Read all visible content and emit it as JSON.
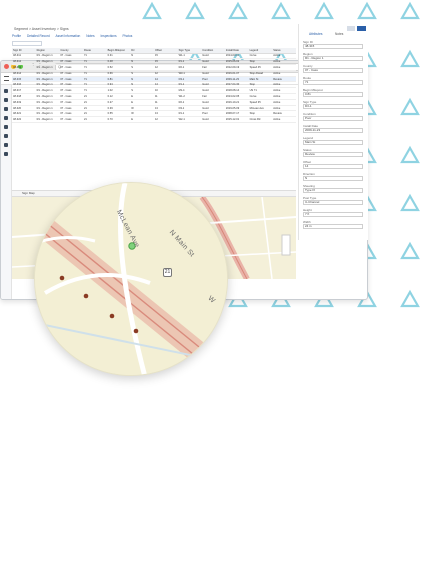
{
  "window": {
    "url": "Q",
    "app_logo": "AgileAssets"
  },
  "breadcrumb": "Segment  >  Asset Inventory  >  Signs",
  "tabs": [
    "Profile",
    "Detailed Record",
    "Asset Information",
    "Notes",
    "Inspections",
    "Photos"
  ],
  "grid": {
    "columns": [
      "Sign ID",
      "Region",
      "County",
      "Route",
      "Begin Milepost",
      "Dir",
      "Offset",
      "Sign Type",
      "Condition",
      "Install Date",
      "Legend",
      "Status"
    ],
    "rows": [
      [
        "48-311",
        "R1 - Region 1",
        "07 - Cass",
        "71",
        "0.31",
        "N",
        "15",
        "W1-1",
        "Good",
        "2014-03-11",
        "Curve",
        "Active"
      ],
      [
        "48-312",
        "R1 - Region 1",
        "07 - Cass",
        "71",
        "0.48",
        "N",
        "15",
        "R1-1",
        "Good",
        "2015-06-02",
        "Stop",
        "Active"
      ],
      [
        "48-313",
        "R1 - Region 1",
        "07 - Cass",
        "71",
        "0.52",
        "S",
        "12",
        "R2-1",
        "Fair",
        "2012-09-19",
        "Speed 45",
        "Active"
      ],
      [
        "48-314",
        "R1 - Region 1",
        "07 - Cass",
        "71",
        "0.66",
        "S",
        "12",
        "W3-1",
        "Good",
        "2016-01-07",
        "Stop Ahead",
        "Active"
      ],
      [
        "48-315",
        "R1 - Region 1",
        "07 - Cass",
        "71",
        "0.81",
        "N",
        "14",
        "D3-1",
        "Poor",
        "2009-11-23",
        "Main St",
        "Review"
      ],
      [
        "48-316",
        "R1 - Region 1",
        "07 - Cass",
        "71",
        "0.94",
        "N",
        "14",
        "R1-1",
        "Good",
        "2017-04-30",
        "Stop",
        "Active"
      ],
      [
        "48-317",
        "R1 - Region 1",
        "07 - Cass",
        "71",
        "1.02",
        "S",
        "10",
        "M1-4",
        "Good",
        "2018-08-14",
        "US 71",
        "Active"
      ],
      [
        "48-318",
        "R1 - Region 1",
        "07 - Cass",
        "21",
        "0.12",
        "E",
        "11",
        "W1-2",
        "Fair",
        "2013-02-05",
        "Curve",
        "Active"
      ],
      [
        "48-319",
        "R1 - Region 1",
        "07 - Cass",
        "21",
        "0.27",
        "E",
        "11",
        "R2-1",
        "Good",
        "2016-10-21",
        "Speed 35",
        "Active"
      ],
      [
        "48-320",
        "R1 - Region 1",
        "07 - Cass",
        "21",
        "0.39",
        "W",
        "13",
        "D3-1",
        "Good",
        "2019-05-09",
        "McLean Ave",
        "Active"
      ],
      [
        "48-321",
        "R1 - Region 1",
        "07 - Cass",
        "21",
        "0.55",
        "W",
        "13",
        "R1-1",
        "Poor",
        "2008-07-17",
        "Stop",
        "Review"
      ],
      [
        "48-322",
        "R1 - Region 1",
        "07 - Cass",
        "21",
        "0.70",
        "E",
        "12",
        "W2-1",
        "Good",
        "2015-12-01",
        "Cross Rd",
        "Active"
      ]
    ],
    "selected_row": 4
  },
  "map_bar": "Sign Map",
  "map": {
    "road_labels": [
      "McLean Ave",
      "N Main St",
      "W"
    ],
    "route_shield": "21"
  },
  "right_panel": {
    "tab_1": "Attributes",
    "tab_2": "Notes",
    "fields": [
      {
        "label": "Sign ID",
        "value": "48-315"
      },
      {
        "label": "Region",
        "value": "R1 - Region 1"
      },
      {
        "label": "County",
        "value": "07 - Cass"
      },
      {
        "label": "Route",
        "value": "71"
      },
      {
        "label": "Begin Milepost",
        "value": "0.81"
      },
      {
        "label": "Sign Type",
        "value": "D3-1"
      },
      {
        "label": "Condition",
        "value": "Poor"
      },
      {
        "label": "Install Date",
        "value": "2009-11-23"
      },
      {
        "label": "Legend",
        "value": "Main St"
      },
      {
        "label": "Status",
        "value": "Review"
      },
      {
        "label": "Offset",
        "value": "14"
      },
      {
        "label": "Direction",
        "value": "N"
      },
      {
        "label": "Sheeting",
        "value": "Type IX"
      },
      {
        "label": "Post Type",
        "value": "U-Channel"
      },
      {
        "label": "Height",
        "value": "7 ft"
      },
      {
        "label": "Width",
        "value": "24 in"
      }
    ]
  },
  "colors": {
    "triangle": "#8fd3e2",
    "map_bg": "#f3efd4",
    "road_red": "#e49a8f",
    "asset_point": "#8a3b24",
    "highlight_green": "#7fd17c"
  }
}
